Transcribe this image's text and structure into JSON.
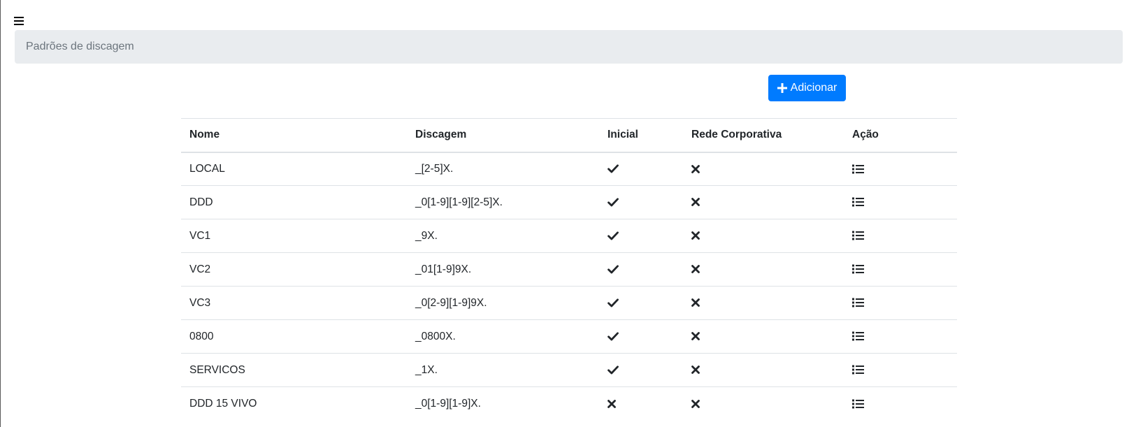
{
  "breadcrumb": {
    "title": "Padrões de discagem"
  },
  "toolbar": {
    "add_label": "Adicionar"
  },
  "table": {
    "headers": [
      "Nome",
      "Discagem",
      "Inicial",
      "Rede Corporativa",
      "Ação"
    ],
    "rows": [
      {
        "nome": "LOCAL",
        "discagem": "_[2-5]X.",
        "inicial": true,
        "rede": false
      },
      {
        "nome": "DDD",
        "discagem": "_0[1-9][1-9][2-5]X.",
        "inicial": true,
        "rede": false
      },
      {
        "nome": "VC1",
        "discagem": "_9X.",
        "inicial": true,
        "rede": false
      },
      {
        "nome": "VC2",
        "discagem": "_01[1-9]9X.",
        "inicial": true,
        "rede": false
      },
      {
        "nome": "VC3",
        "discagem": "_0[2-9][1-9]9X.",
        "inicial": true,
        "rede": false
      },
      {
        "nome": "0800",
        "discagem": "_0800X.",
        "inicial": true,
        "rede": false
      },
      {
        "nome": "SERVICOS",
        "discagem": "_1X.",
        "inicial": true,
        "rede": false
      },
      {
        "nome": "DDD 15 VIVO",
        "discagem": "_0[1-9][1-9]X.",
        "inicial": false,
        "rede": false
      }
    ]
  },
  "icons": {
    "menu": "hamburger-icon",
    "add": "plus-icon",
    "true": "check-icon",
    "false": "times-icon",
    "action": "list-icon"
  },
  "colors": {
    "accent": "#007bff",
    "breadcrumb_bg": "#e9ecef",
    "text": "#212529",
    "muted": "#6c757d"
  }
}
